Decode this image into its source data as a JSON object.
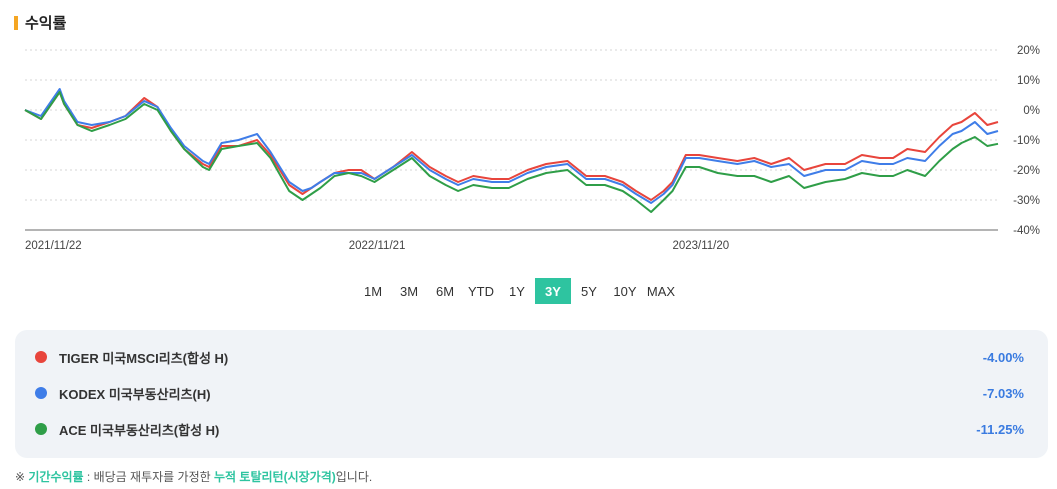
{
  "header": {
    "title": "수익률"
  },
  "chart_data": {
    "type": "line",
    "title": "",
    "ylabel": "",
    "xlabel": "",
    "ylim": [
      -40,
      20
    ],
    "y_ticks": [
      "20%",
      "10%",
      "0%",
      "-10%",
      "-20%",
      "-30%",
      "-40%"
    ],
    "y_tick_values": [
      20,
      10,
      0,
      -10,
      -20,
      -30,
      -40
    ],
    "x_tick_labels": [
      "2021/11/22",
      "2022/11/21",
      "2023/11/20"
    ],
    "x_start": "2021-11-22",
    "x_end": "2024-11-20",
    "grid": true,
    "series": [
      {
        "name": "TIGER 미국MSCI리츠(합성 H)",
        "color": "#e8453c",
        "dates": [
          "2021-11-22",
          "2021-12-10",
          "2021-12-31",
          "2022-01-05",
          "2022-01-20",
          "2022-02-05",
          "2022-02-25",
          "2022-03-15",
          "2022-04-05",
          "2022-04-20",
          "2022-05-05",
          "2022-05-20",
          "2022-06-10",
          "2022-06-17",
          "2022-07-01",
          "2022-07-20",
          "2022-08-10",
          "2022-08-25",
          "2022-09-15",
          "2022-09-30",
          "2022-10-10",
          "2022-10-20",
          "2022-11-05",
          "2022-11-21",
          "2022-12-05",
          "2022-12-20",
          "2023-01-10",
          "2023-01-31",
          "2023-02-20",
          "2023-03-10",
          "2023-03-24",
          "2023-04-10",
          "2023-05-01",
          "2023-05-20",
          "2023-06-10",
          "2023-07-01",
          "2023-07-25",
          "2023-08-15",
          "2023-09-05",
          "2023-09-25",
          "2023-10-10",
          "2023-10-27",
          "2023-11-10",
          "2023-11-20",
          "2023-12-05",
          "2023-12-20",
          "2024-01-10",
          "2024-02-01",
          "2024-02-20",
          "2024-03-10",
          "2024-03-30",
          "2024-04-16",
          "2024-05-10",
          "2024-06-01",
          "2024-06-20",
          "2024-07-10",
          "2024-07-25",
          "2024-08-10",
          "2024-08-30",
          "2024-09-15",
          "2024-09-30",
          "2024-10-10",
          "2024-10-25",
          "2024-11-08",
          "2024-11-20"
        ],
        "values": [
          0,
          -3,
          6,
          2,
          -5,
          -6,
          -4,
          -2,
          4,
          1,
          -7,
          -13,
          -18,
          -19,
          -12,
          -12,
          -10,
          -15,
          -25,
          -28,
          -26,
          -24,
          -21,
          -20,
          -20,
          -23,
          -19,
          -14,
          -19,
          -22,
          -24,
          -22,
          -23,
          -23,
          -20,
          -18,
          -17,
          -22,
          -22,
          -24,
          -27,
          -30,
          -27,
          -24,
          -15,
          -15,
          -16,
          -17,
          -16,
          -18,
          -16,
          -20,
          -18,
          -18,
          -15,
          -16,
          -16,
          -13,
          -14,
          -9,
          -5,
          -4,
          -1,
          -5,
          -4
        ]
      },
      {
        "name": "KODEX 미국부동산리츠(H)",
        "color": "#3f7de8",
        "dates": [
          "2021-11-22",
          "2021-12-10",
          "2021-12-31",
          "2022-01-05",
          "2022-01-20",
          "2022-02-05",
          "2022-02-25",
          "2022-03-15",
          "2022-04-05",
          "2022-04-20",
          "2022-05-05",
          "2022-05-20",
          "2022-06-10",
          "2022-06-17",
          "2022-07-01",
          "2022-07-20",
          "2022-08-10",
          "2022-08-25",
          "2022-09-15",
          "2022-09-30",
          "2022-10-10",
          "2022-10-20",
          "2022-11-05",
          "2022-11-21",
          "2022-12-05",
          "2022-12-20",
          "2023-01-10",
          "2023-01-31",
          "2023-02-20",
          "2023-03-10",
          "2023-03-24",
          "2023-04-10",
          "2023-05-01",
          "2023-05-20",
          "2023-06-10",
          "2023-07-01",
          "2023-07-25",
          "2023-08-15",
          "2023-09-05",
          "2023-09-25",
          "2023-10-10",
          "2023-10-27",
          "2023-11-10",
          "2023-11-20",
          "2023-12-05",
          "2023-12-20",
          "2024-01-10",
          "2024-02-01",
          "2024-02-20",
          "2024-03-10",
          "2024-03-30",
          "2024-04-16",
          "2024-05-10",
          "2024-06-01",
          "2024-06-20",
          "2024-07-10",
          "2024-07-25",
          "2024-08-10",
          "2024-08-30",
          "2024-09-15",
          "2024-09-30",
          "2024-10-10",
          "2024-10-25",
          "2024-11-08",
          "2024-11-20"
        ],
        "values": [
          0,
          -2,
          7,
          3,
          -4,
          -5,
          -4,
          -2,
          3,
          1,
          -6,
          -12,
          -17,
          -18,
          -11,
          -10,
          -8,
          -14,
          -24,
          -27,
          -26,
          -24,
          -21,
          -21,
          -21,
          -23,
          -19,
          -15,
          -20,
          -23,
          -25,
          -23,
          -24,
          -24,
          -21,
          -19,
          -18,
          -23,
          -23,
          -25,
          -28,
          -31,
          -28,
          -25,
          -16,
          -16,
          -17,
          -18,
          -17,
          -19,
          -18,
          -22,
          -20,
          -20,
          -17,
          -18,
          -18,
          -16,
          -17,
          -12,
          -8,
          -7,
          -4,
          -8,
          -7
        ]
      },
      {
        "name": "ACE 미국부동산리츠(합성 H)",
        "color": "#2f9e48",
        "dates": [
          "2021-11-22",
          "2021-12-10",
          "2021-12-31",
          "2022-01-05",
          "2022-01-20",
          "2022-02-05",
          "2022-02-25",
          "2022-03-15",
          "2022-04-05",
          "2022-04-20",
          "2022-05-05",
          "2022-05-20",
          "2022-06-10",
          "2022-06-17",
          "2022-07-01",
          "2022-07-20",
          "2022-08-10",
          "2022-08-25",
          "2022-09-15",
          "2022-09-30",
          "2022-10-10",
          "2022-10-20",
          "2022-11-05",
          "2022-11-21",
          "2022-12-05",
          "2022-12-20",
          "2023-01-10",
          "2023-01-31",
          "2023-02-20",
          "2023-03-10",
          "2023-03-24",
          "2023-04-10",
          "2023-05-01",
          "2023-05-20",
          "2023-06-10",
          "2023-07-01",
          "2023-07-25",
          "2023-08-15",
          "2023-09-05",
          "2023-09-25",
          "2023-10-10",
          "2023-10-27",
          "2023-11-10",
          "2023-11-20",
          "2023-12-05",
          "2023-12-20",
          "2024-01-10",
          "2024-02-01",
          "2024-02-20",
          "2024-03-10",
          "2024-03-30",
          "2024-04-16",
          "2024-05-10",
          "2024-06-01",
          "2024-06-20",
          "2024-07-10",
          "2024-07-25",
          "2024-08-10",
          "2024-08-30",
          "2024-09-15",
          "2024-09-30",
          "2024-10-10",
          "2024-10-25",
          "2024-11-08",
          "2024-11-20"
        ],
        "values": [
          0,
          -3,
          6,
          2,
          -5,
          -7,
          -5,
          -3,
          2,
          0,
          -7,
          -13,
          -19,
          -20,
          -13,
          -12,
          -11,
          -16,
          -27,
          -30,
          -28,
          -26,
          -22,
          -21,
          -22,
          -24,
          -20,
          -16,
          -22,
          -25,
          -27,
          -25,
          -26,
          -26,
          -23,
          -21,
          -20,
          -25,
          -25,
          -27,
          -30,
          -34,
          -30,
          -27,
          -19,
          -19,
          -21,
          -22,
          -22,
          -24,
          -22,
          -26,
          -24,
          -23,
          -21,
          -22,
          -22,
          -20,
          -22,
          -17,
          -13,
          -11,
          -9,
          -12,
          -11.25
        ]
      }
    ]
  },
  "range_buttons": [
    "1M",
    "3M",
    "6M",
    "YTD",
    "1Y",
    "3Y",
    "5Y",
    "10Y",
    "MAX"
  ],
  "range_active": "3Y",
  "legend": [
    {
      "name": "TIGER 미국MSCI리츠(합성 H)",
      "value": "-4.00%",
      "color": "#e8453c"
    },
    {
      "name": "KODEX 미국부동산리츠(H)",
      "value": "-7.03%",
      "color": "#3f7de8"
    },
    {
      "name": "ACE 미국부동산리츠(합성 H)",
      "value": "-11.25%",
      "color": "#2f9e48"
    }
  ],
  "footnote": {
    "prefix": "※ ",
    "highlight1": "기간수익률",
    "middle": " : 배당금 재투자를 가정한 ",
    "highlight2": "누적 토탈리턴(시장가격)",
    "suffix": "입니다."
  }
}
